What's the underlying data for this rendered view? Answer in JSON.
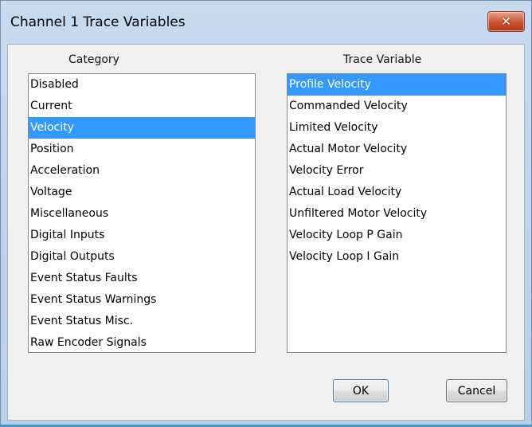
{
  "window": {
    "title": "Channel 1 Trace Variables",
    "close_label": "✕"
  },
  "category": {
    "heading": "Category",
    "items": [
      "Disabled",
      "Current",
      "Velocity",
      "Position",
      "Acceleration",
      "Voltage",
      "Miscellaneous",
      "Digital Inputs",
      "Digital Outputs",
      "Event Status Faults",
      "Event Status Warnings",
      "Event Status Misc.",
      "Raw Encoder Signals"
    ],
    "selected_index": 2
  },
  "trace": {
    "heading": "Trace Variable",
    "items": [
      "Profile Velocity",
      "Commanded Velocity",
      "Limited Velocity",
      "Actual Motor Velocity",
      "Velocity Error",
      "Actual Load Velocity",
      "Unfiltered Motor Velocity",
      "Velocity Loop P Gain",
      "Velocity Loop I Gain"
    ],
    "selected_index": 0
  },
  "buttons": {
    "ok_label": "OK",
    "cancel_label": "Cancel"
  },
  "colors": {
    "selection": "#3399ff",
    "selection_text": "#ffffff",
    "window_frame": "#b9cfe8",
    "close_button": "#c7512f"
  }
}
